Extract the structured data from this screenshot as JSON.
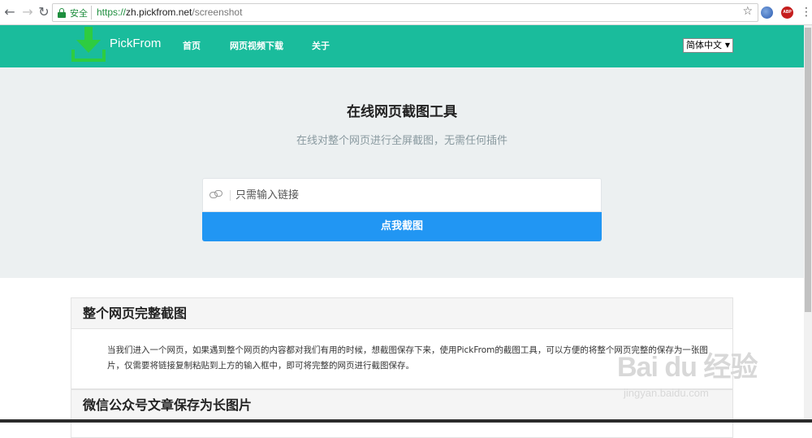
{
  "browser": {
    "secure_label": "安全",
    "url_scheme": "https://",
    "url_host": "zh.pickfrom.net",
    "url_path": "/screenshot",
    "abp_label": "ABP"
  },
  "header": {
    "brand": "PickFrom",
    "nav": [
      "首页",
      "网页视频下载",
      "关于"
    ],
    "language": "简体中文"
  },
  "hero": {
    "title": "在线网页截图工具",
    "subtitle": "在线对整个网页进行全屏截图，无需任何插件",
    "input_placeholder": "只需输入链接",
    "button_label": "点我截图"
  },
  "sections": [
    {
      "title": "整个网页完整截图",
      "body": "当我们进入一个网页，如果遇到整个网页的内容都对我们有用的时候，想截图保存下来，使用PickFrom的截图工具，可以方便的将整个网页完整的保存为一张图片，仅需要将链接复制粘贴到上方的输入框中，即可将完整的网页进行截图保存。"
    },
    {
      "title": "微信公众号文章保存为长图片"
    }
  ],
  "watermark": {
    "main": "Bai du 经验",
    "sub": "jingyan.baidu.com"
  },
  "colors": {
    "header_bg": "#1abc9c",
    "hero_bg": "#ecf0f1",
    "button_bg": "#2196f3",
    "logo_green": "#2ecc40"
  }
}
